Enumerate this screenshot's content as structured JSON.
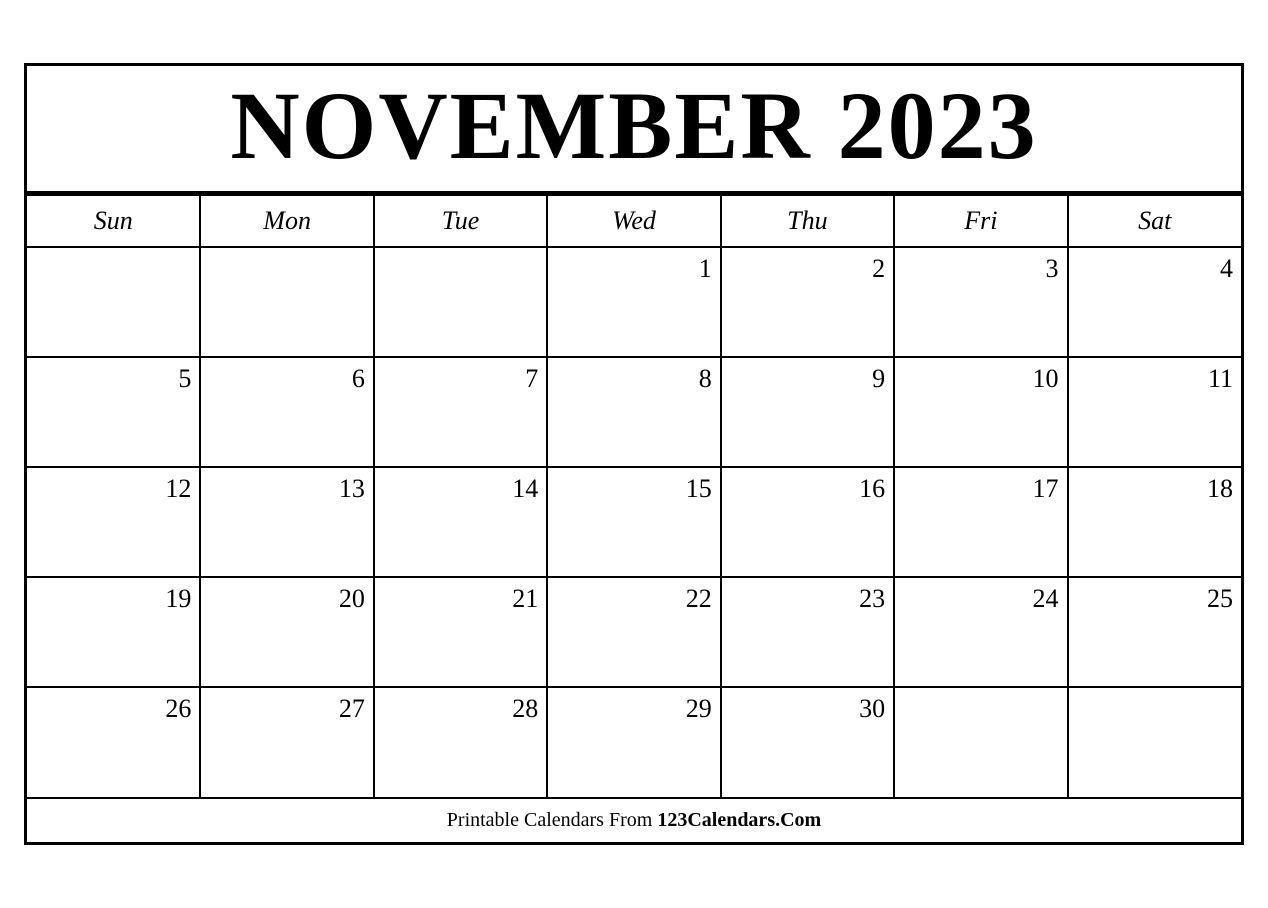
{
  "header": {
    "title": "NOVEMBER 2023"
  },
  "days_of_week": [
    "Sun",
    "Mon",
    "Tue",
    "Wed",
    "Thu",
    "Fri",
    "Sat"
  ],
  "weeks": [
    [
      null,
      null,
      null,
      1,
      2,
      3,
      4
    ],
    [
      5,
      6,
      7,
      8,
      9,
      10,
      11
    ],
    [
      12,
      13,
      14,
      15,
      16,
      17,
      18
    ],
    [
      19,
      20,
      21,
      22,
      23,
      24,
      25
    ],
    [
      26,
      27,
      28,
      29,
      30,
      null,
      null
    ]
  ],
  "footer": {
    "text_plain": "Printable Calendars From ",
    "text_bold": "123Calendars.Com"
  }
}
